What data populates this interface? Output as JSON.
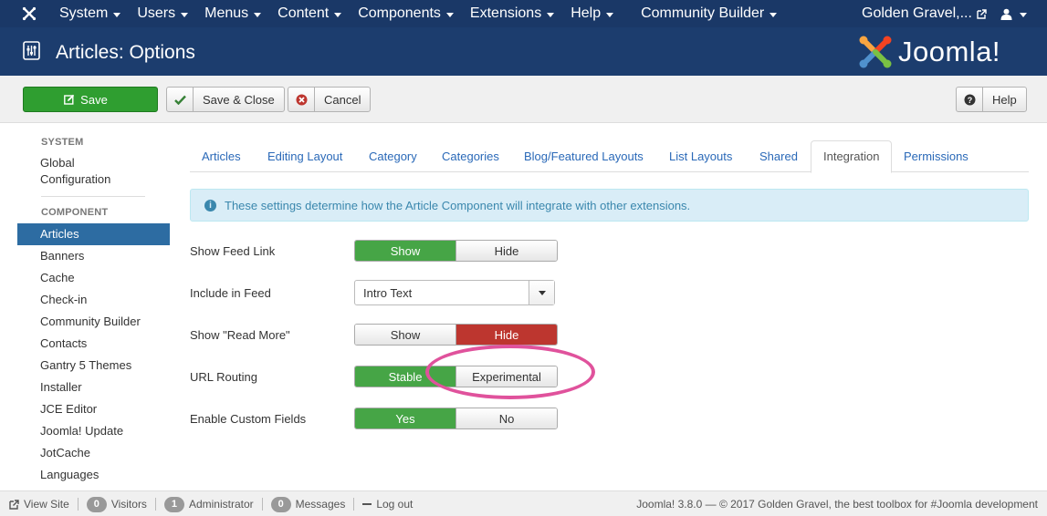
{
  "navbar": {
    "logo_icon": "joomla-icon",
    "menu": [
      "System",
      "Users",
      "Menus",
      "Content",
      "Components",
      "Extensions",
      "Help",
      "Community Builder"
    ],
    "site_link": "Golden Gravel,...",
    "site_link_icon": "external-link-icon",
    "user_icon": "user-icon"
  },
  "header": {
    "title": "Articles: Options",
    "title_icon": "options-icon",
    "brand": "Joomla!"
  },
  "toolbar": {
    "save": "Save",
    "save_close": "Save & Close",
    "cancel": "Cancel",
    "help": "Help"
  },
  "sidebar": {
    "system_heading": "SYSTEM",
    "global_config": "Global Configuration",
    "component_heading": "COMPONENT",
    "items": [
      "Articles",
      "Banners",
      "Cache",
      "Check-in",
      "Community Builder",
      "Contacts",
      "Gantry 5 Themes",
      "Installer",
      "JCE Editor",
      "Joomla! Update",
      "JotCache",
      "Languages"
    ],
    "active": "Articles"
  },
  "tabs": {
    "items": [
      "Articles",
      "Editing Layout",
      "Category",
      "Categories",
      "Blog/Featured Layouts",
      "List Layouts",
      "Shared",
      "Integration",
      "Permissions"
    ],
    "active": "Integration"
  },
  "alert": {
    "text": "These settings determine how the Article Component will integrate with other extensions."
  },
  "form": {
    "show_feed_link": {
      "label": "Show Feed Link",
      "on": "Show",
      "off": "Hide",
      "selected": "Show"
    },
    "include_in_feed": {
      "label": "Include in Feed",
      "value": "Intro Text"
    },
    "show_read_more": {
      "label": "Show \"Read More\"",
      "on": "Show",
      "off": "Hide",
      "selected": "Hide"
    },
    "url_routing": {
      "label": "URL Routing",
      "on": "Stable",
      "off": "Experimental",
      "selected": "Stable"
    },
    "enable_custom_fields": {
      "label": "Enable Custom Fields",
      "on": "Yes",
      "off": "No",
      "selected": "Yes"
    }
  },
  "status": {
    "view_site": "View Site",
    "visitors_count": "0",
    "visitors": "Visitors",
    "admin_count": "1",
    "admin": "Administrator",
    "messages_count": "0",
    "messages": "Messages",
    "logout": "Log out",
    "footer": "Joomla! 3.8.0 — © 2017 Golden Gravel, the best toolbox for #Joomla development"
  },
  "colors": {
    "navbar": "#1a3867",
    "header": "#1c3d6e",
    "save_green": "#2f9e30",
    "toggle_green": "#46a546",
    "toggle_red": "#bd362f",
    "sidebar_active": "#2d6ca2",
    "annotation": "#e0529c"
  }
}
